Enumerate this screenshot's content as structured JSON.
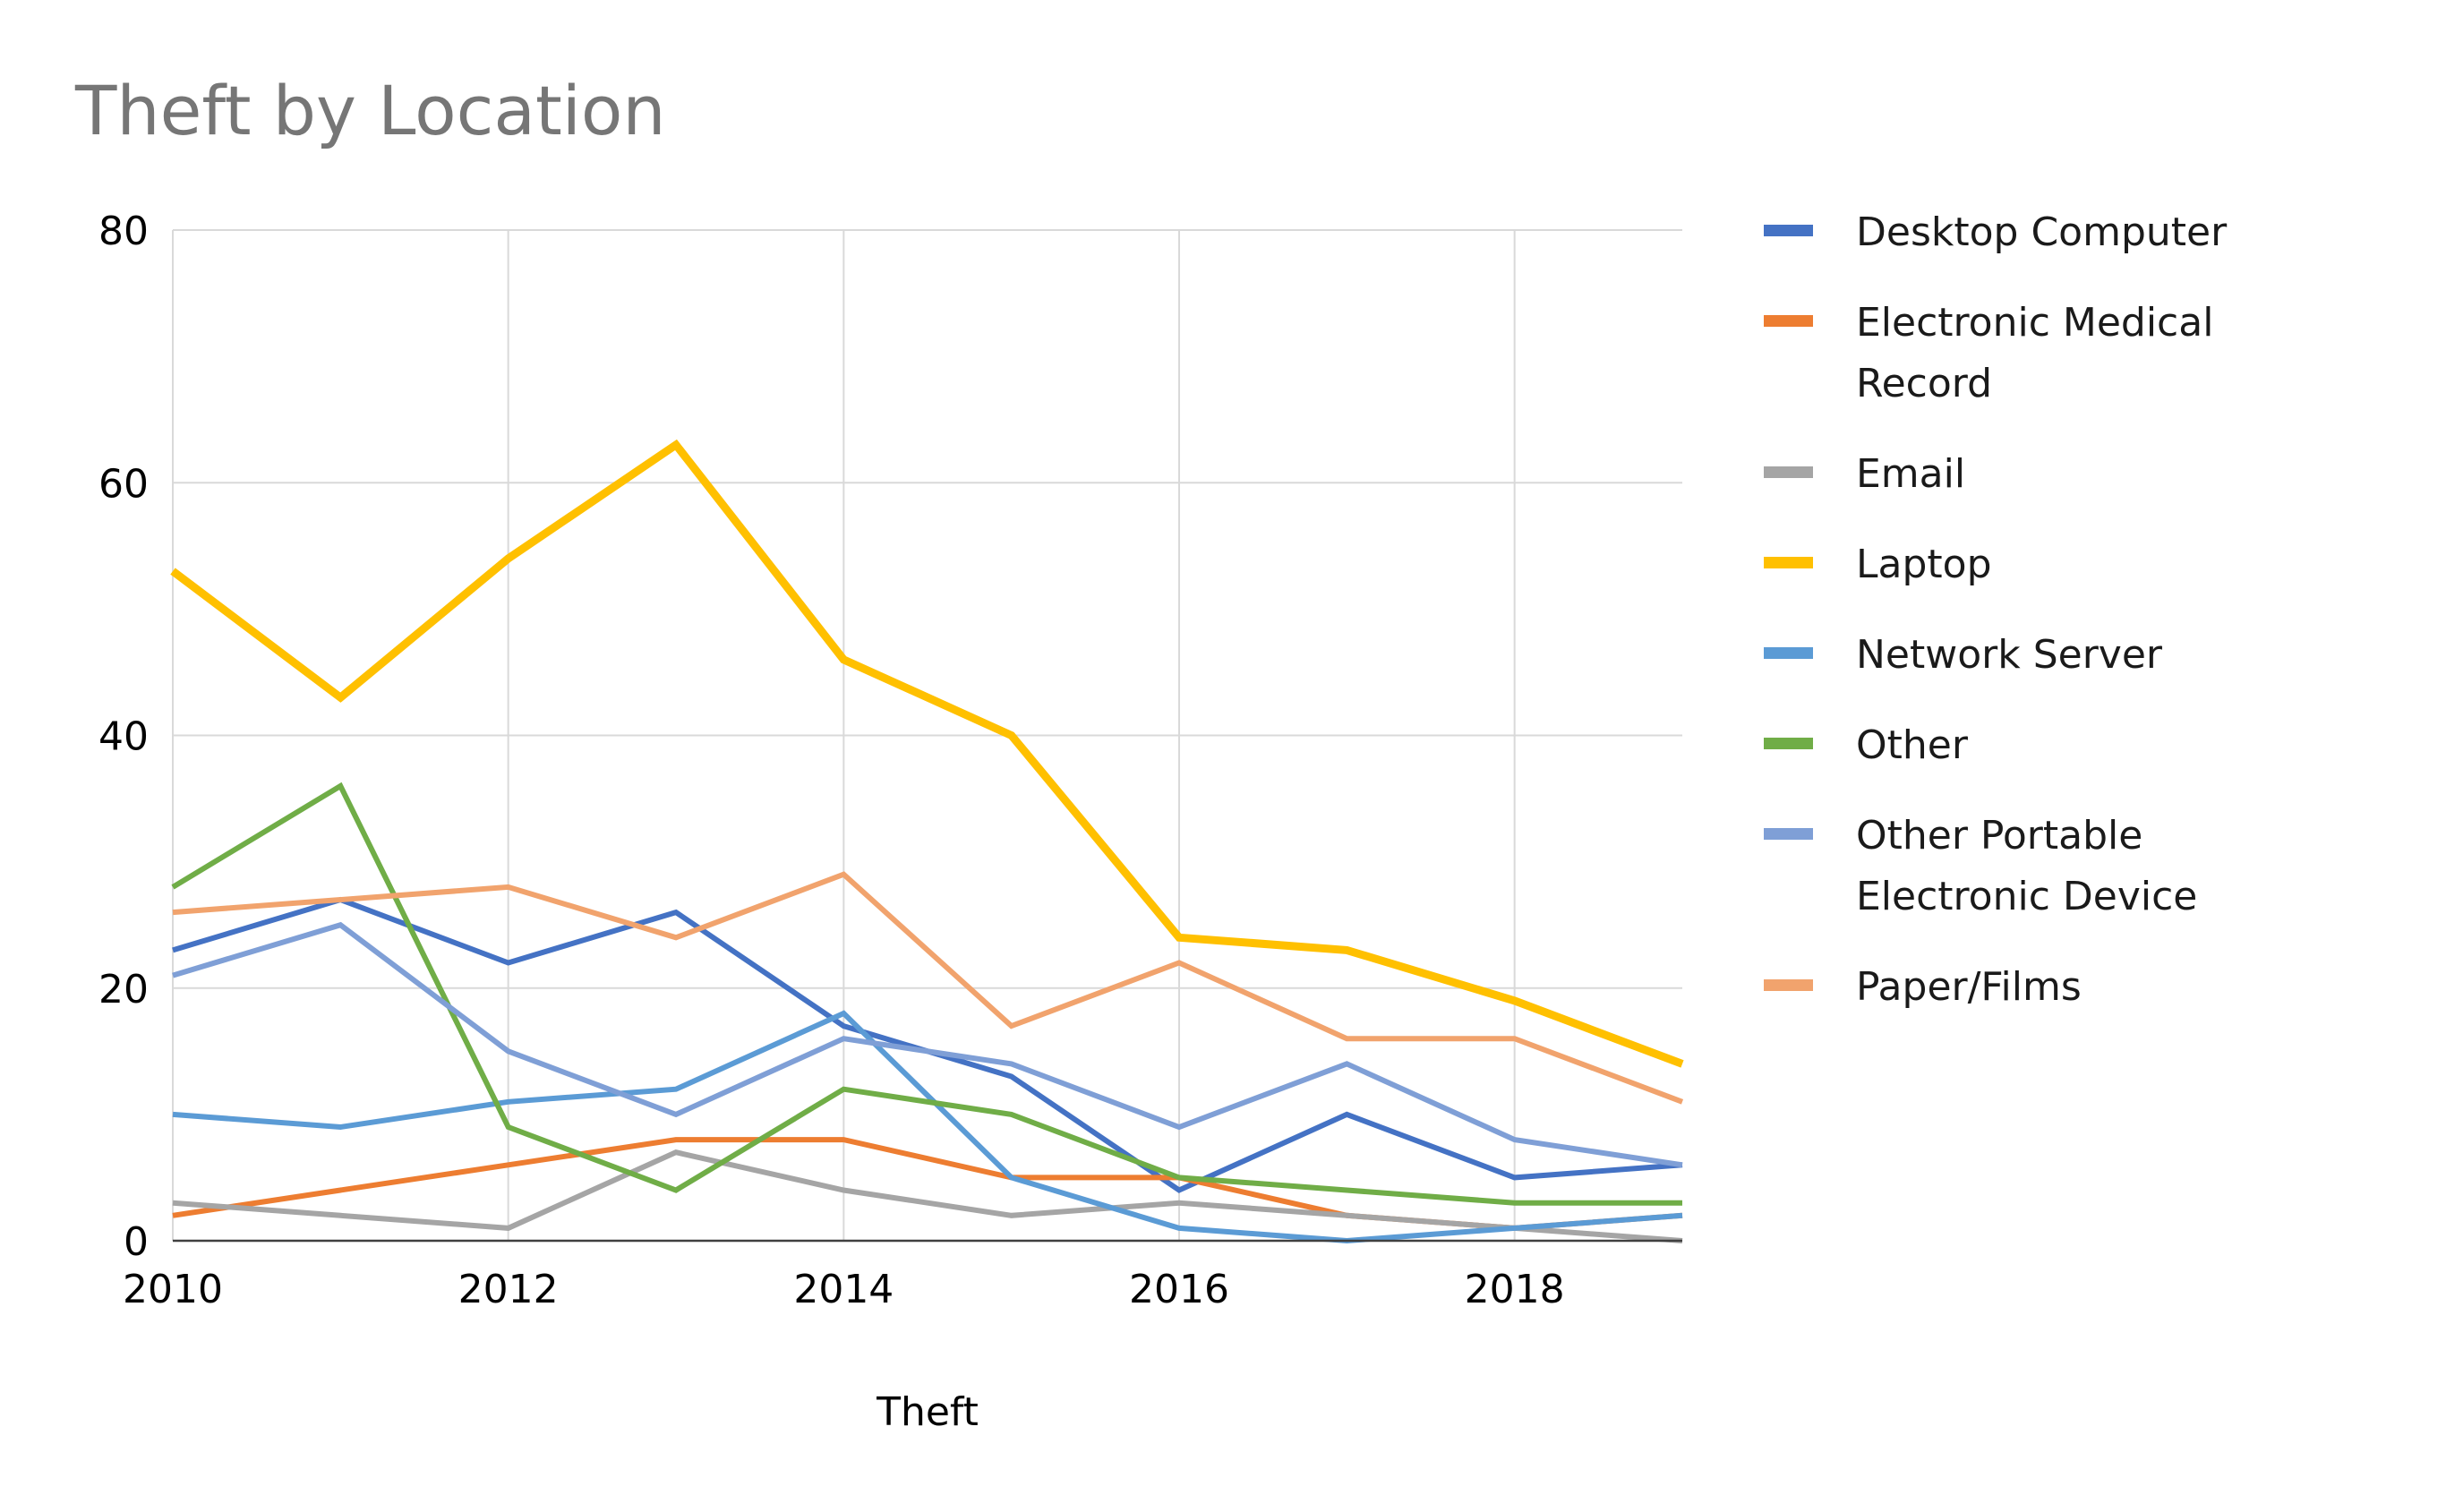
{
  "chart_data": {
    "type": "line",
    "title": "Theft by Location",
    "xlabel": "Theft",
    "ylabel": "",
    "x": [
      2010,
      2011,
      2012,
      2013,
      2014,
      2015,
      2016,
      2017,
      2018,
      2019
    ],
    "xlim": [
      2010,
      2019
    ],
    "ylim": [
      0,
      80
    ],
    "x_ticks": [
      "2010",
      "2012",
      "2014",
      "2016",
      "2018"
    ],
    "x_tick_values": [
      2010,
      2012,
      2014,
      2016,
      2018
    ],
    "y_ticks": [
      "0",
      "20",
      "40",
      "60",
      "80"
    ],
    "y_tick_values": [
      0,
      20,
      40,
      60,
      80
    ],
    "grid": true,
    "legend_position": "right",
    "series": [
      {
        "name": "Desktop Computer",
        "color": "#4472C4",
        "values": [
          23,
          27,
          22,
          26,
          17,
          13,
          4,
          10,
          5,
          6
        ]
      },
      {
        "name": "Electronic Medical Record",
        "legend_lines": [
          "Electronic Medical",
          "Record"
        ],
        "color": "#ED7D31",
        "values": [
          2,
          4,
          6,
          8,
          8,
          5,
          5,
          2,
          1,
          2
        ]
      },
      {
        "name": "Email",
        "color": "#A5A5A5",
        "values": [
          3,
          2,
          1,
          7,
          4,
          2,
          3,
          2,
          1,
          0
        ]
      },
      {
        "name": "Laptop",
        "color": "#FFC000",
        "emphasized": true,
        "values": [
          53,
          43,
          54,
          63,
          46,
          40,
          24,
          23,
          19,
          14
        ]
      },
      {
        "name": "Network Server",
        "color": "#5B9BD5",
        "values": [
          10,
          9,
          11,
          12,
          18,
          5,
          1,
          0,
          1,
          2
        ]
      },
      {
        "name": "Other",
        "color": "#70AD47",
        "values": [
          28,
          36,
          9,
          4,
          12,
          10,
          5,
          4,
          3,
          3
        ]
      },
      {
        "name": "Other Portable Electronic Device",
        "legend_lines": [
          "Other Portable",
          "Electronic Device"
        ],
        "color": "#7F9FD6",
        "values": [
          21,
          25,
          15,
          10,
          16,
          14,
          9,
          14,
          8,
          6
        ]
      },
      {
        "name": "Paper/Films",
        "color": "#F1A36D",
        "values": [
          26,
          27,
          28,
          24,
          29,
          17,
          22,
          16,
          16,
          11
        ]
      }
    ]
  }
}
